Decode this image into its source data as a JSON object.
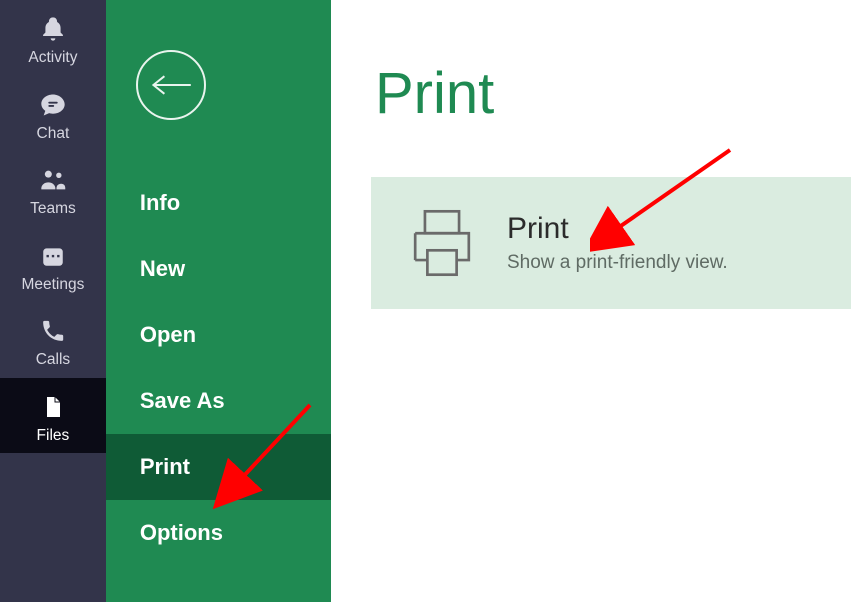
{
  "rail": {
    "items": [
      {
        "label": "Activity",
        "icon": "bell"
      },
      {
        "label": "Chat",
        "icon": "chat"
      },
      {
        "label": "Teams",
        "icon": "teams"
      },
      {
        "label": "Meetings",
        "icon": "calendar"
      },
      {
        "label": "Calls",
        "icon": "phone"
      },
      {
        "label": "Files",
        "icon": "file"
      }
    ],
    "selected": "Files"
  },
  "backstage": {
    "items": [
      {
        "label": "Info"
      },
      {
        "label": "New"
      },
      {
        "label": "Open"
      },
      {
        "label": "Save As"
      },
      {
        "label": "Print"
      },
      {
        "label": "Options"
      }
    ],
    "selected": "Print"
  },
  "main": {
    "title": "Print",
    "card": {
      "heading": "Print",
      "subtitle": "Show a print-friendly view."
    }
  },
  "colors": {
    "rail_bg": "#33344a",
    "backstage_bg": "#1f8a52",
    "backstage_selected": "#0f5b36",
    "title_color": "#1f8a52",
    "card_bg": "#daece0"
  }
}
